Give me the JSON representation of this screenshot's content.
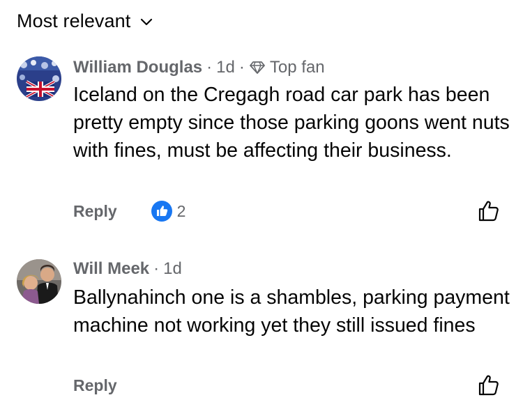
{
  "sort": {
    "label": "Most relevant",
    "icon": "chevron-down-icon"
  },
  "comments": [
    {
      "author": "William Douglas",
      "separator": "·",
      "time": "1d",
      "badge": "Top fan",
      "badge_icon": "diamond-icon",
      "text": "Iceland on the Cregagh road car park has been pretty empty since those parking goons went nuts with fines, must be affecting their business.",
      "reply_label": "Reply",
      "reaction_count": "2",
      "reaction_icon": "like-reaction-icon",
      "like_icon": "thumbs-up-outline-icon"
    },
    {
      "author": "Will Meek",
      "separator": "·",
      "time": "1d",
      "text": "Ballynahinch one is a shambles, parking payment machine not working yet they still issued fines",
      "reply_label": "Reply",
      "like_icon": "thumbs-up-outline-icon"
    }
  ],
  "colors": {
    "text_primary": "#050505",
    "text_secondary": "#65676b",
    "like_blue": "#1877f2"
  }
}
